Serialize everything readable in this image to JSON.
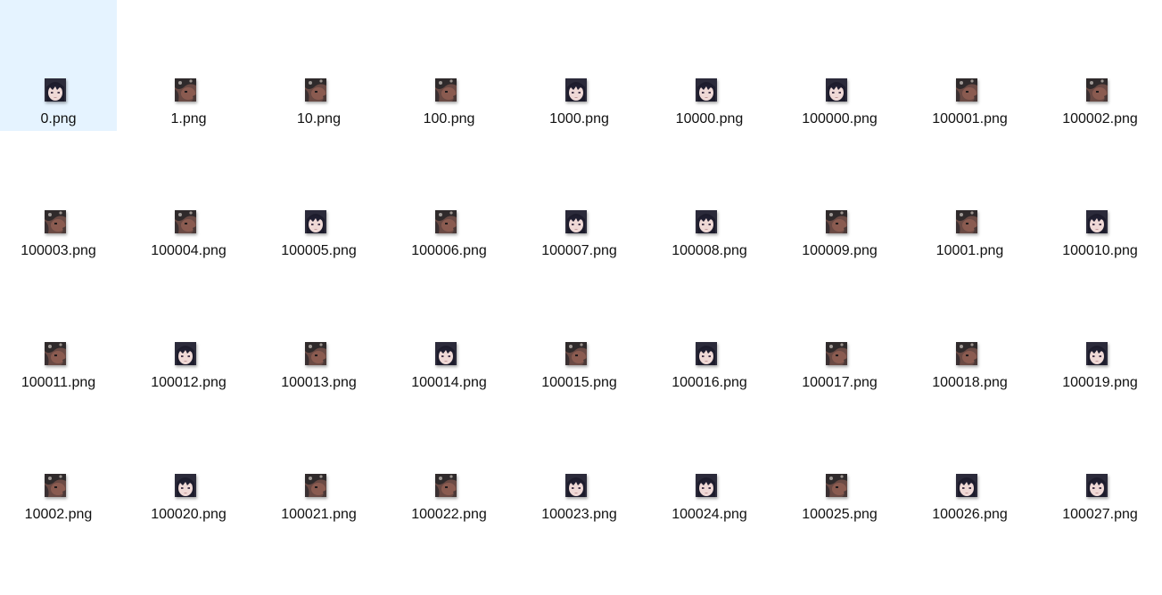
{
  "files": [
    {
      "name": "0.png",
      "thumb": "face",
      "selected": true
    },
    {
      "name": "1.png",
      "thumb": "dark"
    },
    {
      "name": "10.png",
      "thumb": "dark"
    },
    {
      "name": "100.png",
      "thumb": "dark"
    },
    {
      "name": "1000.png",
      "thumb": "face"
    },
    {
      "name": "10000.png",
      "thumb": "face"
    },
    {
      "name": "100000.png",
      "thumb": "face"
    },
    {
      "name": "100001.png",
      "thumb": "dark"
    },
    {
      "name": "100002.png",
      "thumb": "dark"
    },
    {
      "name": "100003.png",
      "thumb": "dark"
    },
    {
      "name": "100004.png",
      "thumb": "dark"
    },
    {
      "name": "100005.png",
      "thumb": "face"
    },
    {
      "name": "100006.png",
      "thumb": "dark"
    },
    {
      "name": "100007.png",
      "thumb": "face"
    },
    {
      "name": "100008.png",
      "thumb": "face"
    },
    {
      "name": "100009.png",
      "thumb": "dark"
    },
    {
      "name": "10001.png",
      "thumb": "dark"
    },
    {
      "name": "100010.png",
      "thumb": "face"
    },
    {
      "name": "100011.png",
      "thumb": "dark"
    },
    {
      "name": "100012.png",
      "thumb": "face"
    },
    {
      "name": "100013.png",
      "thumb": "dark"
    },
    {
      "name": "100014.png",
      "thumb": "face"
    },
    {
      "name": "100015.png",
      "thumb": "dark"
    },
    {
      "name": "100016.png",
      "thumb": "face"
    },
    {
      "name": "100017.png",
      "thumb": "dark"
    },
    {
      "name": "100018.png",
      "thumb": "dark"
    },
    {
      "name": "100019.png",
      "thumb": "face"
    },
    {
      "name": "10002.png",
      "thumb": "dark"
    },
    {
      "name": "100020.png",
      "thumb": "face"
    },
    {
      "name": "100021.png",
      "thumb": "dark"
    },
    {
      "name": "100022.png",
      "thumb": "dark"
    },
    {
      "name": "100023.png",
      "thumb": "face"
    },
    {
      "name": "100024.png",
      "thumb": "face"
    },
    {
      "name": "100025.png",
      "thumb": "dark"
    },
    {
      "name": "100026.png",
      "thumb": "face"
    },
    {
      "name": "100027.png",
      "thumb": "face"
    }
  ],
  "colors": {
    "selection": "#e5f3ff",
    "label": "#111111"
  }
}
